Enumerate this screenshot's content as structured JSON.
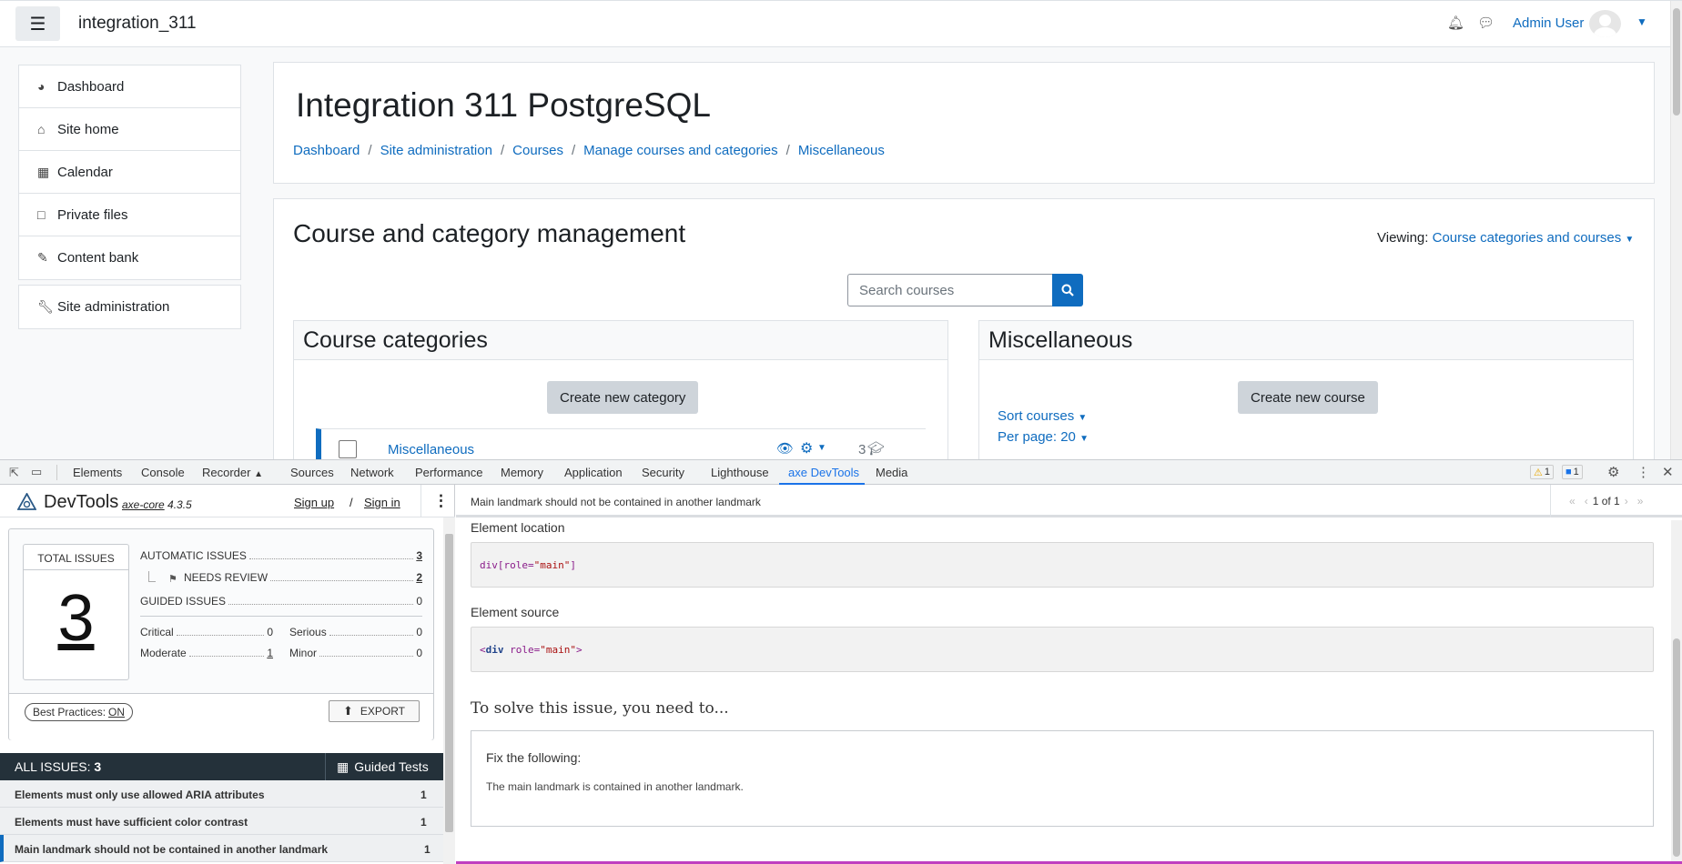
{
  "moodle": {
    "site_name": "integration_311",
    "user_name": "Admin User",
    "sidebar": [
      {
        "label": "Dashboard",
        "icon": "dashboard-icon"
      },
      {
        "label": "Site home",
        "icon": "home-icon"
      },
      {
        "label": "Calendar",
        "icon": "calendar-icon"
      },
      {
        "label": "Private files",
        "icon": "file-icon"
      },
      {
        "label": "Content bank",
        "icon": "brush-icon"
      },
      {
        "label": "Site administration",
        "icon": "wrench-icon"
      }
    ],
    "page_title": "Integration 311 PostgreSQL",
    "breadcrumb": [
      "Dashboard",
      "Site administration",
      "Courses",
      "Manage courses and categories",
      "Miscellaneous"
    ],
    "mgmt_title": "Course and category management",
    "viewing_label": "Viewing:",
    "viewing_value": "Course categories and courses",
    "search_placeholder": "Search courses",
    "categories_heading": "Course categories",
    "create_category": "Create new category",
    "category_name": "Miscellaneous",
    "category_count": "3",
    "misc_heading": "Miscellaneous",
    "create_course": "Create new course",
    "sort_courses": "Sort courses",
    "per_page": "Per page: 20"
  },
  "devtools": {
    "tabs": [
      "Elements",
      "Console",
      "Recorder",
      "Sources",
      "Network",
      "Performance",
      "Memory",
      "Application",
      "Security",
      "Lighthouse",
      "axe DevTools",
      "Media"
    ],
    "active_tab": "axe DevTools",
    "warn_count": "1",
    "msg_count": "1"
  },
  "axe": {
    "brand": "DevTools",
    "core_name": "axe-core",
    "core_version": "4.3.5",
    "sign_up": "Sign up",
    "separator": "/",
    "sign_in": "Sign in",
    "total_label": "TOTAL ISSUES",
    "total": "3",
    "automatic_label": "AUTOMATIC ISSUES",
    "automatic": "3",
    "needs_review_label": "NEEDS REVIEW",
    "needs_review": "2",
    "guided_label": "GUIDED ISSUES",
    "guided": "0",
    "critical_label": "Critical",
    "critical": "0",
    "serious_label": "Serious",
    "serious": "0",
    "moderate_label": "Moderate",
    "moderate": "1",
    "minor_label": "Minor",
    "minor": "0",
    "best_practices_label": "Best Practices:",
    "best_practices_value": "ON",
    "export_label": "EXPORT",
    "all_issues_label": "ALL ISSUES:",
    "all_issues_count": "3",
    "guided_tests_label": "Guided Tests",
    "issues": [
      {
        "title": "Elements must only use allowed ARIA attributes",
        "count": "1"
      },
      {
        "title": "Elements must have sufficient color contrast",
        "count": "1"
      },
      {
        "title": "Main landmark should not be contained in another landmark",
        "count": "1"
      }
    ],
    "selected_issue": "Main landmark should not be contained in another landmark",
    "pager": "1 of 1",
    "element_location_label": "Element location",
    "location_tag": "div",
    "location_attr": "role",
    "location_value": "\"main\"",
    "element_source_label": "Element source",
    "source_tag": "div",
    "source_attr": "role",
    "source_value": "\"main\"",
    "solve_title": "To solve this issue, you need to...",
    "fix_title": "Fix the following:",
    "fix_desc": "The main landmark is contained in another landmark."
  }
}
